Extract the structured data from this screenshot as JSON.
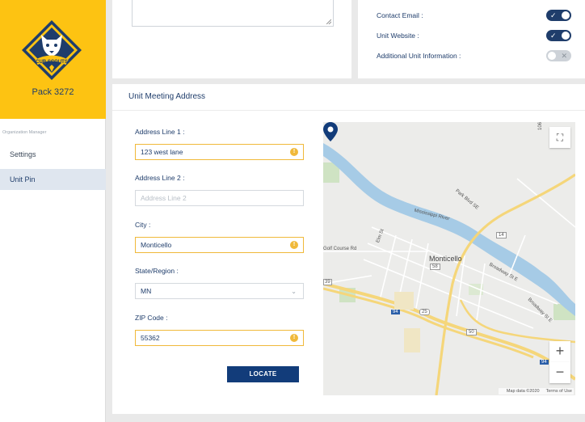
{
  "sidebar": {
    "pack_name": "Pack 3272",
    "logo_text": "CUB SCOUTS",
    "org_label": "Organization Manager",
    "items": [
      {
        "label": "Settings"
      },
      {
        "label": "Unit Pin"
      }
    ]
  },
  "contact_settings": {
    "toggles": [
      {
        "label": "Contact Email :",
        "on": true
      },
      {
        "label": "Unit Website :",
        "on": true
      },
      {
        "label": "Additional Unit Information :",
        "on": false
      }
    ]
  },
  "address": {
    "title": "Unit Meeting Address",
    "line1": {
      "label": "Address Line 1 :",
      "value": "123 west lane"
    },
    "line2": {
      "label": "Address Line 2 :",
      "placeholder": "Address Line 2"
    },
    "city": {
      "label": "City :",
      "value": "Monticello"
    },
    "state": {
      "label": "State/Region :",
      "value": "MN"
    },
    "zip": {
      "label": "ZIP Code :",
      "value": "55362"
    },
    "locate_label": "LOCATE"
  },
  "map": {
    "city": "Monticello",
    "labels": {
      "river": "Mississippi River",
      "park_blvd": "Park Blvd SE",
      "broadway": "Broadway St E",
      "broadway2": "Broadway St E",
      "elm": "Elm St",
      "golf": "Golf Course Rd",
      "r14": "14",
      "r58": "58",
      "r25": "25",
      "r50": "50",
      "r94": "94",
      "r94b": "94",
      "r39": "39",
      "r106": "106"
    },
    "attribution": "Map data ©2020",
    "terms": "Terms of Use"
  },
  "colors": {
    "brand_yellow": "#fdc312",
    "navy": "#1f3d6b",
    "button": "#123c7a",
    "warning": "#f0b93a"
  }
}
